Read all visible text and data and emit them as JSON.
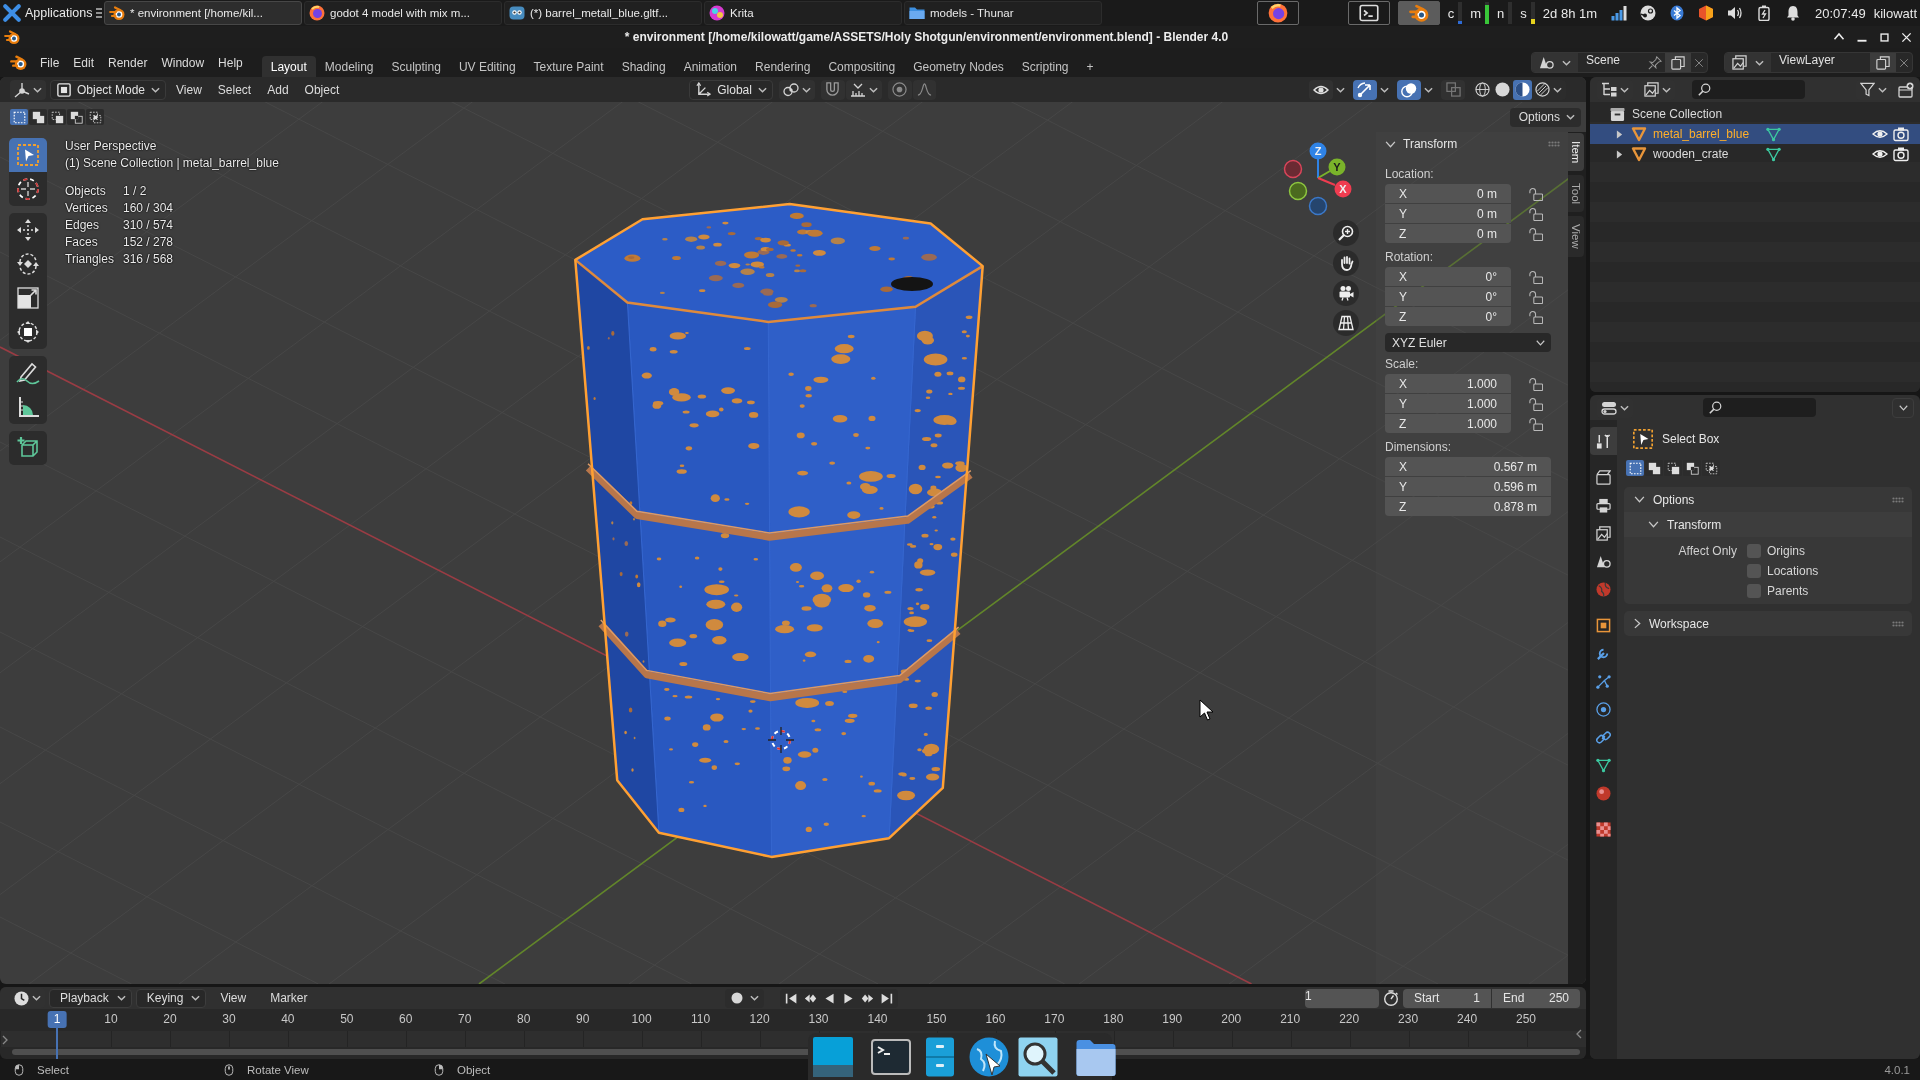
{
  "taskbar": {
    "menu": "Applications",
    "windows": [
      {
        "title": "* environment [/home/kil...",
        "selected": true
      },
      {
        "title": "godot 4 model with mix m...",
        "selected": false
      },
      {
        "title": "(*) barrel_metall_blue.gltf...",
        "selected": false
      },
      {
        "title": "Krita",
        "selected": false
      },
      {
        "title": "models - Thunar",
        "selected": false
      }
    ],
    "launchers": [
      {
        "selected": false
      },
      {
        "selected": false
      },
      {
        "selected": true
      }
    ],
    "meters": [
      {
        "label": "c",
        "level": 0.12,
        "color": "#2e6bd6"
      },
      {
        "label": "m",
        "level": 0.85,
        "color": "#39c639"
      },
      {
        "label": "n"
      },
      {
        "label": "s",
        "level": 0.25,
        "color": "#e6d31e"
      }
    ],
    "uptime": "2d 8h 1m",
    "clock": "20:07:49",
    "user": "kilowatt"
  },
  "window": {
    "title": "* environment [/home/kilowatt/game/ASSETS/Holy Shotgun/environment/environment.blend] - Blender 4.0"
  },
  "menu": [
    "File",
    "Edit",
    "Render",
    "Window",
    "Help"
  ],
  "workspaces": [
    {
      "label": "Layout",
      "selected": true
    },
    {
      "label": "Modeling",
      "selected": false
    },
    {
      "label": "Sculpting",
      "selected": false
    },
    {
      "label": "UV Editing",
      "selected": false
    },
    {
      "label": "Texture Paint",
      "selected": false
    },
    {
      "label": "Shading",
      "selected": false
    },
    {
      "label": "Animation",
      "selected": false
    },
    {
      "label": "Rendering",
      "selected": false
    },
    {
      "label": "Compositing",
      "selected": false
    },
    {
      "label": "Geometry Nodes",
      "selected": false
    },
    {
      "label": "Scripting",
      "selected": false
    }
  ],
  "add_workspace": "+",
  "scene": "Scene",
  "view_layer": "ViewLayer",
  "viewport": {
    "mode": "Object Mode",
    "menus": [
      "View",
      "Select",
      "Add",
      "Object"
    ],
    "orientation": "Global",
    "tool_toggles": [
      {
        "on": false
      },
      {
        "on": false
      }
    ],
    "toggles": [
      {
        "on": false
      },
      {
        "on": true
      },
      {
        "on": true
      },
      {
        "on": false
      }
    ],
    "shading": [
      {
        "selected": false
      },
      {
        "selected": false
      },
      {
        "selected": true
      },
      {
        "selected": false
      }
    ],
    "select_modes": [
      {
        "selected": true
      },
      {
        "selected": false
      },
      {
        "selected": false
      },
      {
        "selected": false
      },
      {
        "selected": false
      }
    ],
    "options": "Options",
    "tools": [
      {
        "selected": true
      },
      {
        "selected": false
      },
      {
        "selected": false
      },
      {
        "selected": false
      },
      {
        "selected": false
      },
      {
        "selected": false
      },
      {
        "selected": false
      },
      {
        "selected": false
      },
      {
        "selected": false
      }
    ],
    "info": {
      "view": "User Perspective",
      "object": "(1) Scene Collection | metal_barrel_blue"
    },
    "stats": [
      {
        "label": "Objects",
        "value": "1 / 2"
      },
      {
        "label": "Vertices",
        "value": "160 / 304"
      },
      {
        "label": "Edges",
        "value": "310 / 574"
      },
      {
        "label": "Faces",
        "value": "152 / 278"
      },
      {
        "label": "Triangles",
        "value": "316 / 568"
      }
    ],
    "gizmo_axes": [
      "Z",
      "Y",
      "X"
    ]
  },
  "sidebar": {
    "tabs": [
      {
        "label": "Item",
        "selected": true
      },
      {
        "label": "Tool",
        "selected": false
      },
      {
        "label": "View",
        "selected": false
      }
    ],
    "panel": {
      "label": "Transform",
      "expanded": true
    },
    "sections": [
      {
        "kind": "vector",
        "label": "Location:",
        "locks": true,
        "fields": [
          {
            "axis": "X",
            "value": "0 m"
          },
          {
            "axis": "Y",
            "value": "0 m"
          },
          {
            "axis": "Z",
            "value": "0 m"
          }
        ]
      },
      {
        "kind": "vector",
        "label": "Rotation:",
        "locks": true,
        "fields": [
          {
            "axis": "X",
            "value": "0°"
          },
          {
            "axis": "Y",
            "value": "0°"
          },
          {
            "axis": "Z",
            "value": "0°"
          }
        ]
      },
      {
        "kind": "dropdown",
        "value": "XYZ Euler"
      },
      {
        "kind": "vector",
        "label": "Scale:",
        "locks": true,
        "fields": [
          {
            "axis": "X",
            "value": "1.000"
          },
          {
            "axis": "Y",
            "value": "1.000"
          },
          {
            "axis": "Z",
            "value": "1.000"
          }
        ]
      },
      {
        "kind": "vector",
        "label": "Dimensions:",
        "locks": false,
        "fields": [
          {
            "axis": "X",
            "value": "0.567 m"
          },
          {
            "axis": "Y",
            "value": "0.596 m"
          },
          {
            "axis": "Z",
            "value": "0.878 m"
          }
        ]
      }
    ]
  },
  "outliner": {
    "root": "Scene Collection",
    "items": [
      {
        "name": "metal_barrel_blue",
        "selected": true,
        "expanded": false
      },
      {
        "name": "wooden_crate",
        "selected": false,
        "expanded": false
      }
    ]
  },
  "properties": {
    "tabs": [
      {
        "selected": true
      },
      {
        "selected": false
      },
      {
        "selected": false
      },
      {
        "selected": false
      },
      {
        "selected": false
      },
      {
        "selected": false
      },
      {
        "selected": false
      },
      {
        "selected": false
      },
      {
        "selected": false
      },
      {
        "selected": false
      },
      {
        "selected": false
      },
      {
        "selected": false
      },
      {
        "selected": false
      },
      {
        "selected": false
      }
    ],
    "tool": "Select Box",
    "modes": [
      {
        "selected": true
      },
      {
        "selected": false
      },
      {
        "selected": false
      },
      {
        "selected": false
      },
      {
        "selected": false
      }
    ],
    "panels": [
      {
        "label": "Options",
        "expanded": true,
        "children": [
          {
            "label": "Transform",
            "expanded": true,
            "group": "Affect Only",
            "options": [
              {
                "label": "Origins",
                "checked": false
              },
              {
                "label": "Locations",
                "checked": false
              },
              {
                "label": "Parents",
                "checked": false
              }
            ]
          }
        ]
      },
      {
        "label": "Workspace",
        "expanded": false
      }
    ]
  },
  "timeline": {
    "menus": [
      {
        "label": "Playback",
        "kind": "dropdown"
      },
      {
        "label": "Keying",
        "kind": "dropdown"
      },
      {
        "label": "View",
        "kind": "menu"
      },
      {
        "label": "Marker",
        "kind": "menu"
      }
    ],
    "frame": "1",
    "start": {
      "label": "Start",
      "value": "1"
    },
    "end": {
      "label": "End",
      "value": "250"
    },
    "ruler": [
      {
        "label": "1",
        "selected": true
      },
      {
        "label": "10",
        "selected": false
      },
      {
        "label": "20",
        "selected": false
      },
      {
        "label": "30",
        "selected": false
      },
      {
        "label": "40",
        "selected": false
      },
      {
        "label": "50",
        "selected": false
      },
      {
        "label": "60",
        "selected": false
      },
      {
        "label": "70",
        "selected": false
      },
      {
        "label": "80",
        "selected": false
      },
      {
        "label": "90",
        "selected": false
      },
      {
        "label": "100",
        "selected": false
      },
      {
        "label": "110",
        "selected": false
      },
      {
        "label": "120",
        "selected": false
      },
      {
        "label": "130",
        "selected": false
      },
      {
        "label": "140",
        "selected": false
      },
      {
        "label": "150",
        "selected": false
      },
      {
        "label": "160",
        "selected": false
      },
      {
        "label": "170",
        "selected": false
      },
      {
        "label": "180",
        "selected": false
      },
      {
        "label": "190",
        "selected": false
      },
      {
        "label": "200",
        "selected": false
      },
      {
        "label": "210",
        "selected": false
      },
      {
        "label": "220",
        "selected": false
      },
      {
        "label": "230",
        "selected": false
      },
      {
        "label": "240",
        "selected": false
      },
      {
        "label": "250",
        "selected": false
      }
    ]
  },
  "status_bar": {
    "hints": [
      "Select",
      "Rotate View",
      "Object"
    ],
    "version": "4.0.1"
  }
}
